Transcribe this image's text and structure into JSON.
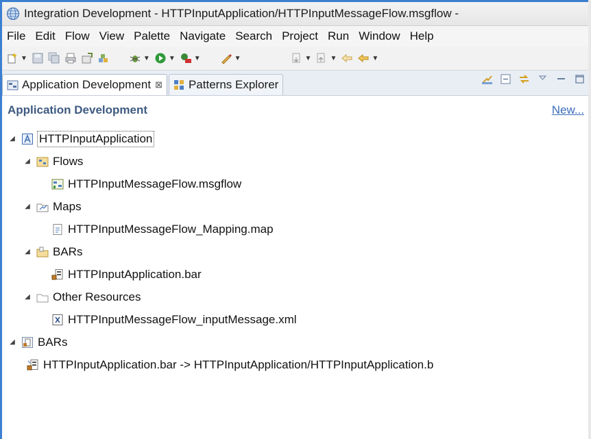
{
  "window": {
    "title": "Integration Development - HTTPInputApplication/HTTPInputMessageFlow.msgflow -"
  },
  "menubar": [
    "File",
    "Edit",
    "Flow",
    "View",
    "Palette",
    "Navigate",
    "Search",
    "Project",
    "Run",
    "Window",
    "Help"
  ],
  "tabs": {
    "active": {
      "label": "Application Development",
      "close": "⊠"
    },
    "inactive": {
      "label": "Patterns Explorer"
    }
  },
  "view": {
    "heading": "Application Development",
    "new_link": "New..."
  },
  "tree": {
    "application": "HTTPInputApplication",
    "flows_folder": "Flows",
    "flow_file": "HTTPInputMessageFlow.msgflow",
    "maps_folder": "Maps",
    "map_file": "HTTPInputMessageFlow_Mapping.map",
    "bars_folder": "BARs",
    "bar_file": "HTTPInputApplication.bar",
    "other_folder": "Other Resources",
    "xml_file": "HTTPInputMessageFlow_inputMessage.xml",
    "root_bars": "BARs",
    "root_bar_link": "HTTPInputApplication.bar -> HTTPInputApplication/HTTPInputApplication.b"
  },
  "colors": {
    "accent_border": "#3c7fd1",
    "heading": "#3e5a80",
    "link": "#3b6db8"
  }
}
